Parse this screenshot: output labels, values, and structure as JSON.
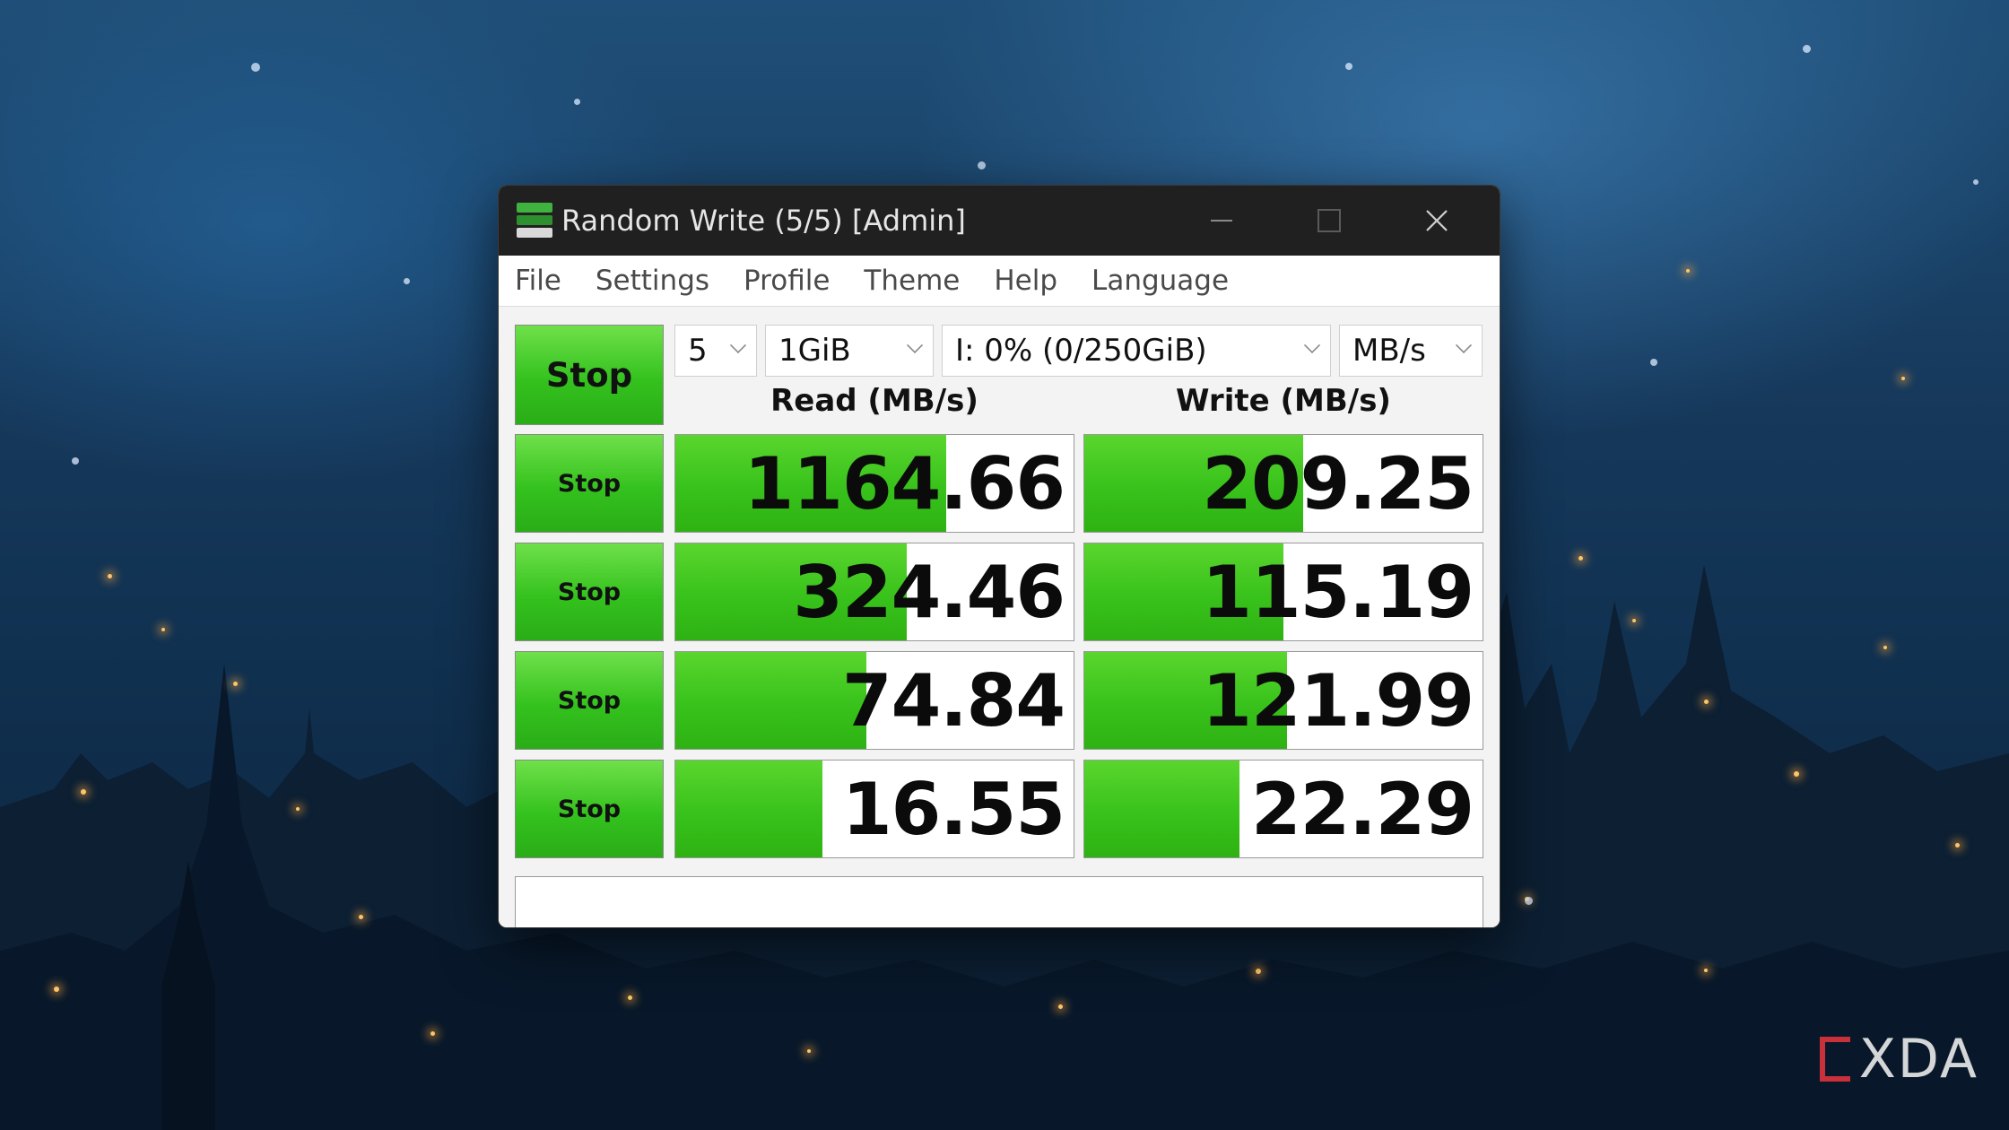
{
  "window": {
    "title": "Random Write (5/5) [Admin]",
    "icon": "crystaldiskmark-icon",
    "controls": [
      "minimize-icon",
      "maximize-icon",
      "close-icon"
    ]
  },
  "menu": [
    "File",
    "Settings",
    "Profile",
    "Theme",
    "Help",
    "Language"
  ],
  "toolbar": {
    "all_button": "Stop",
    "count": "5",
    "size": "1GiB",
    "drive": "I: 0% (0/250GiB)",
    "unit": "MB/s"
  },
  "headers": {
    "read": "Read (MB/s)",
    "write": "Write (MB/s)"
  },
  "rows": [
    {
      "button": "Stop",
      "read": "1164.66",
      "write": "209.25",
      "read_fill": 0.68,
      "write_fill": 0.55
    },
    {
      "button": "Stop",
      "read": "324.46",
      "write": "115.19",
      "read_fill": 0.58,
      "write_fill": 0.5
    },
    {
      "button": "Stop",
      "read": "74.84",
      "write": "121.99",
      "read_fill": 0.48,
      "write_fill": 0.51
    },
    {
      "button": "Stop",
      "read": "16.55",
      "write": "22.29",
      "read_fill": 0.37,
      "write_fill": 0.39
    }
  ],
  "status": "",
  "watermark": "XDA",
  "colors": {
    "bar_green": "#38c21b",
    "titlebar": "#202020",
    "watermark_accent": "#c8303a"
  }
}
